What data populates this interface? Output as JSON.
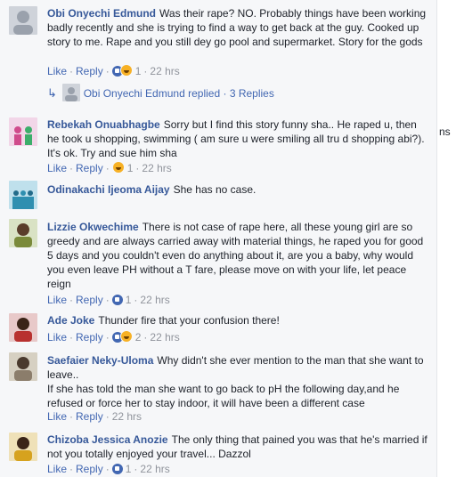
{
  "actions": {
    "like": "Like",
    "reply": "Reply",
    "sep": "·"
  },
  "comments": [
    {
      "name": "Obi Onyechi Edmund",
      "text": "Was their rape? NO. Probably things have been working badly recently and she is trying to find a way to get back at the guy. Cooked up story to me. Rape and you still dey go pool and supermarket. Story for the gods",
      "reactions": "1",
      "time": "22 hrs"
    },
    {
      "name": "Rebekah Onuabhagbe",
      "text": "Sorry but I find this story funny sha.. He raped u, then he took u shopping, swimming ( am sure u were smiling all tru d shopping abi?). It's ok. Try and sue him sha",
      "reactions": "1",
      "time": "22 hrs"
    },
    {
      "name": "Odinakachi Ijeoma Aijay",
      "text": "She has no case.",
      "reactions": "",
      "time": ""
    },
    {
      "name": "Lizzie Okwechime",
      "text": "There is not case of rape here, all these young girl are so greedy and are always carried away with material things, he raped you for good 5 days and you couldn't even do anything about it, are you a baby, why would you even leave PH without a T fare, please move on with your life, let peace reign",
      "reactions": "1",
      "time": "22 hrs"
    },
    {
      "name": "Ade Joke",
      "text": "Thunder fire that your confusion there!",
      "reactions": "2",
      "time": "22 hrs"
    },
    {
      "name": "Saefaier Neky-Uloma",
      "text": "Why didn't she ever mention to the man that she want to leave..",
      "text2": "If she has told the man she want to go back to pH the following day,and he refused or force her to stay indoor, it will have been a different case",
      "reactions": "",
      "time": "22 hrs"
    },
    {
      "name": "Chizoba Jessica Anozie",
      "text": "The only thing that pained you was that he's married if not you totally enjoyed your travel... Dazzol",
      "reactions": "1",
      "time": "22 hrs"
    }
  ],
  "reply_summary": {
    "name": "Obi Onyechi Edmund",
    "verb": "replied",
    "sep": "·",
    "count": "3 Replies"
  },
  "side_text": "ns",
  "colors": {
    "link": "#365899",
    "action": "#4267b2",
    "muted": "#90949c",
    "background": "#f6f7f9"
  }
}
